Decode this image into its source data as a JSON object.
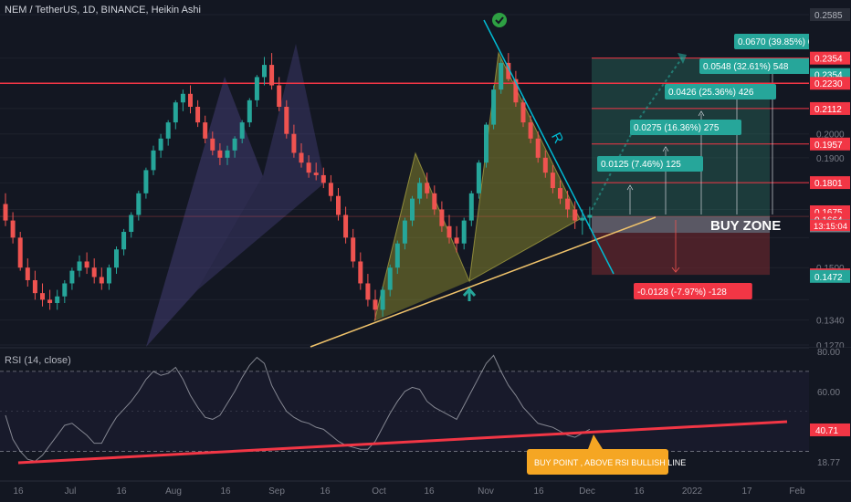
{
  "header": {
    "title": "NEM / TetherUS, 1D, BINANCE, Heikin Ashi"
  },
  "rsi_panel": {
    "title": "RSI (14, close)"
  },
  "colors": {
    "background": "#131722",
    "up": "#26a69a",
    "down": "#ef5350",
    "pattern_purple": "#5b4f9e",
    "pattern_olive": "#9c9a2e",
    "target_green": "#2e7d6b",
    "stop_red": "#7a2a30",
    "trendline": "#f0c36b"
  },
  "chart_data": [
    {
      "type": "candlestick",
      "title": "NEM / TetherUS, 1D, BINANCE, Heikin Ashi",
      "x_ticks": [
        "16",
        "Jul",
        "16",
        "Aug",
        "16",
        "Sep",
        "16",
        "Oct",
        "16",
        "Nov",
        "16",
        "Dec",
        "16",
        "2022",
        "17",
        "Feb"
      ],
      "y_ticks": [
        "0.2585",
        "0.2354",
        "0.2230",
        "0.2000",
        "0.1900",
        "0.1700",
        "0.1500",
        "0.1340",
        "0.1270"
      ],
      "scale": "log",
      "ylim": [
        0.127,
        0.2585
      ],
      "candle_series": {
        "open": [
          0.172,
          0.166,
          0.16,
          0.15,
          0.146,
          0.142,
          0.14,
          0.139,
          0.141,
          0.145,
          0.149,
          0.152,
          0.15,
          0.147,
          0.145,
          0.15,
          0.156,
          0.162,
          0.168,
          0.176,
          0.185,
          0.193,
          0.198,
          0.205,
          0.214,
          0.218,
          0.212,
          0.205,
          0.198,
          0.193,
          0.19,
          0.193,
          0.198,
          0.205,
          0.215,
          0.226,
          0.232,
          0.222,
          0.212,
          0.2,
          0.192,
          0.188,
          0.184,
          0.183,
          0.18,
          0.175,
          0.168,
          0.16,
          0.152,
          0.145,
          0.14,
          0.137,
          0.143,
          0.15,
          0.158,
          0.166,
          0.174,
          0.18,
          0.176,
          0.17,
          0.164,
          0.16,
          0.158,
          0.166,
          0.176,
          0.188,
          0.204,
          0.22,
          0.233,
          0.225,
          0.214,
          0.205,
          0.198,
          0.19,
          0.184,
          0.178,
          0.174,
          0.17,
          0.166,
          0.167
        ],
        "high": [
          0.176,
          0.169,
          0.162,
          0.153,
          0.149,
          0.145,
          0.143,
          0.143,
          0.146,
          0.15,
          0.154,
          0.155,
          0.153,
          0.15,
          0.151,
          0.157,
          0.163,
          0.169,
          0.177,
          0.186,
          0.195,
          0.2,
          0.206,
          0.215,
          0.22,
          0.222,
          0.215,
          0.208,
          0.201,
          0.196,
          0.195,
          0.199,
          0.206,
          0.216,
          0.227,
          0.236,
          0.238,
          0.226,
          0.215,
          0.204,
          0.196,
          0.191,
          0.188,
          0.186,
          0.183,
          0.178,
          0.171,
          0.163,
          0.155,
          0.148,
          0.143,
          0.144,
          0.151,
          0.159,
          0.167,
          0.175,
          0.182,
          0.184,
          0.179,
          0.173,
          0.168,
          0.164,
          0.167,
          0.177,
          0.189,
          0.205,
          0.222,
          0.235,
          0.238,
          0.229,
          0.217,
          0.208,
          0.201,
          0.193,
          0.187,
          0.181,
          0.177,
          0.173,
          0.17,
          0.171
        ],
        "low": [
          0.164,
          0.158,
          0.149,
          0.144,
          0.14,
          0.138,
          0.137,
          0.137,
          0.139,
          0.143,
          0.147,
          0.148,
          0.145,
          0.143,
          0.143,
          0.148,
          0.154,
          0.16,
          0.166,
          0.174,
          0.183,
          0.19,
          0.195,
          0.202,
          0.21,
          0.209,
          0.203,
          0.196,
          0.191,
          0.187,
          0.187,
          0.19,
          0.196,
          0.203,
          0.212,
          0.222,
          0.22,
          0.21,
          0.198,
          0.19,
          0.186,
          0.182,
          0.181,
          0.178,
          0.173,
          0.166,
          0.158,
          0.15,
          0.143,
          0.138,
          0.134,
          0.135,
          0.141,
          0.148,
          0.156,
          0.164,
          0.172,
          0.174,
          0.168,
          0.162,
          0.158,
          0.155,
          0.156,
          0.164,
          0.174,
          0.186,
          0.202,
          0.218,
          0.224,
          0.212,
          0.203,
          0.196,
          0.188,
          0.182,
          0.176,
          0.172,
          0.167,
          0.163,
          0.161,
          0.163
        ],
        "close": [
          0.166,
          0.16,
          0.15,
          0.146,
          0.142,
          0.14,
          0.139,
          0.141,
          0.145,
          0.149,
          0.152,
          0.15,
          0.147,
          0.145,
          0.15,
          0.156,
          0.162,
          0.168,
          0.176,
          0.185,
          0.193,
          0.198,
          0.205,
          0.214,
          0.218,
          0.212,
          0.205,
          0.198,
          0.193,
          0.19,
          0.193,
          0.198,
          0.205,
          0.215,
          0.226,
          0.232,
          0.222,
          0.212,
          0.2,
          0.192,
          0.188,
          0.184,
          0.183,
          0.18,
          0.175,
          0.168,
          0.16,
          0.152,
          0.145,
          0.14,
          0.137,
          0.143,
          0.15,
          0.158,
          0.166,
          0.174,
          0.18,
          0.176,
          0.17,
          0.164,
          0.16,
          0.158,
          0.166,
          0.176,
          0.188,
          0.204,
          0.22,
          0.233,
          0.225,
          0.214,
          0.205,
          0.198,
          0.19,
          0.184,
          0.178,
          0.174,
          0.17,
          0.166,
          0.167,
          0.168
        ]
      },
      "horizontal_levels": [
        {
          "value": 0.223,
          "label": "0.2230",
          "color": "#f23645"
        }
      ],
      "price_labels": [
        {
          "value": 0.2585,
          "text": "0.2585",
          "kind": "muted"
        },
        {
          "value": 0.2354,
          "text": "0.2354",
          "kind": "red"
        },
        {
          "value": 0.2354,
          "text": "0.2354",
          "kind": "green"
        },
        {
          "value": 0.223,
          "text": "0.2230",
          "kind": "red"
        },
        {
          "value": 0.2112,
          "text": "0.2112",
          "kind": "red"
        },
        {
          "value": 0.1957,
          "text": "0.1957",
          "kind": "red"
        },
        {
          "value": 0.1801,
          "text": "0.1801",
          "kind": "red"
        },
        {
          "value": 0.1675,
          "text": "0.1675",
          "kind": "current"
        },
        {
          "value": 0.1664,
          "text": "0.1664",
          "kind": "red"
        },
        {
          "value": 0.1641,
          "text": "0.1641",
          "kind": "grey"
        },
        {
          "value": 0.1477,
          "text": "0.1477",
          "kind": "red"
        },
        {
          "value": 0.1472,
          "text": "0.1472",
          "kind": "green"
        }
      ],
      "countdown": "13:15:04",
      "position_targets": [
        {
          "price": 0.1801,
          "text": "0.0125 (7.46%) 125"
        },
        {
          "price": 0.1957,
          "text": "0.0275 (16.36%) 275"
        },
        {
          "price": 0.2112,
          "text": "0.0426 (25.36%) 426"
        },
        {
          "price": 0.223,
          "text": "0.0548 (32.61%) 548"
        },
        {
          "price": 0.2354,
          "text": "0.0670 (39.85%) 670"
        }
      ],
      "stop": {
        "price": 0.1477,
        "text": "-0.0128 (-7.97%) -128"
      },
      "entry_price": 0.1675,
      "annotations": {
        "buy_zone": "BUY ZONE",
        "resistance": "R"
      }
    },
    {
      "type": "line",
      "title": "RSI (14, close)",
      "ylim": [
        18.77,
        80
      ],
      "y_ticks": [
        "80.00",
        "60.00",
        "40.71",
        "18.77"
      ],
      "bands": [
        70,
        30
      ],
      "last_value": "40.71",
      "values": [
        48,
        36,
        30,
        26,
        25,
        28,
        33,
        38,
        43,
        44,
        41,
        38,
        34,
        34,
        41,
        47,
        51,
        55,
        60,
        66,
        70,
        68,
        69,
        72,
        66,
        58,
        52,
        47,
        46,
        48,
        54,
        60,
        67,
        73,
        77,
        74,
        63,
        56,
        50,
        47,
        45,
        44,
        42,
        41,
        38,
        35,
        33,
        32,
        31,
        31,
        35,
        42,
        49,
        55,
        60,
        62,
        61,
        55,
        52,
        50,
        48,
        46,
        53,
        60,
        67,
        74,
        78,
        70,
        63,
        58,
        52,
        48,
        44,
        43,
        42,
        40,
        38,
        37,
        39,
        41
      ],
      "series": [
        {
          "values": []
        }
      ],
      "annotation": "BUY POINT , ABOVE RSI BULLISH LINE"
    }
  ]
}
